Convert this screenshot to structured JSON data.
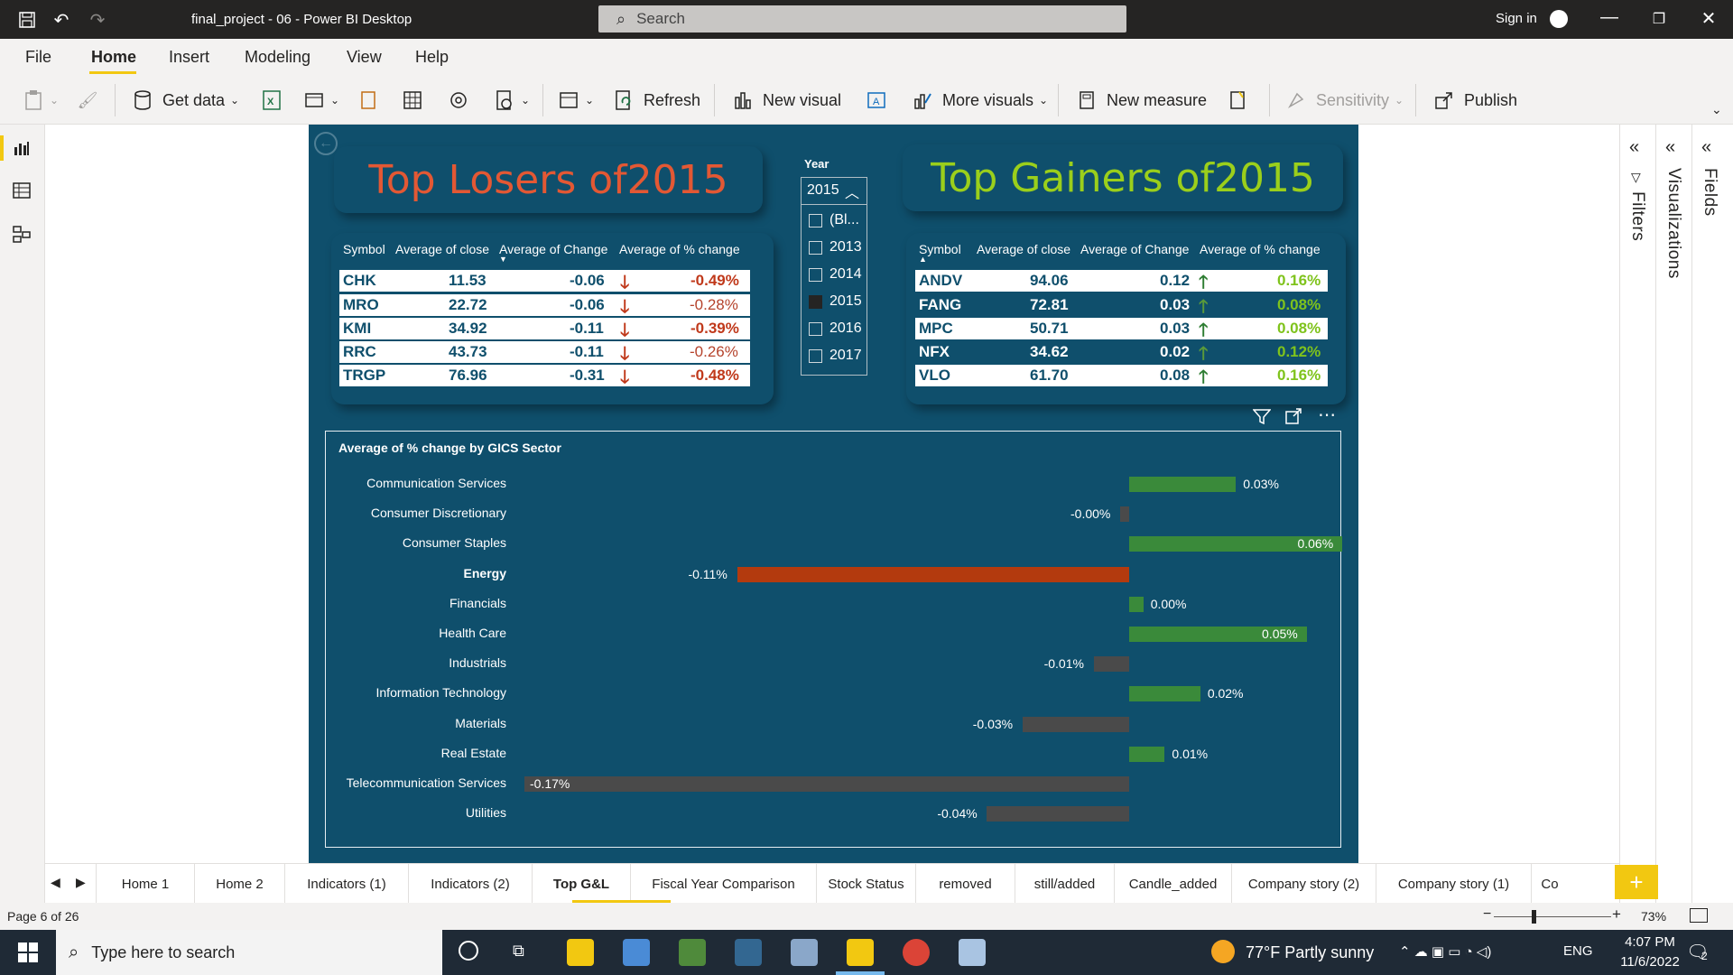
{
  "window": {
    "title": "final_project - 06 - Power BI Desktop",
    "search_placeholder": "Search",
    "sign_in": "Sign in"
  },
  "menu": {
    "items": [
      "File",
      "Home",
      "Insert",
      "Modeling",
      "View",
      "Help"
    ],
    "active": "Home"
  },
  "ribbon": {
    "get_data": "Get data",
    "refresh": "Refresh",
    "new_visual": "New visual",
    "more_visuals": "More visuals",
    "new_measure": "New measure",
    "sensitivity": "Sensitivity",
    "publish": "Publish"
  },
  "panes": {
    "filters": "Filters",
    "visualizations": "Visualizations",
    "fields": "Fields"
  },
  "report": {
    "losers_title": "Top Losers of2015",
    "gainers_title": "Top Gainers of2015",
    "table_headers": [
      "Symbol",
      "Average of close",
      "Average of Change",
      "Average of % change"
    ],
    "losers": [
      {
        "symbol": "CHK",
        "close": "11.53",
        "change": "-0.06",
        "pct": "-0.49%"
      },
      {
        "symbol": "MRO",
        "close": "22.72",
        "change": "-0.06",
        "pct": "-0.28%"
      },
      {
        "symbol": "KMI",
        "close": "34.92",
        "change": "-0.11",
        "pct": "-0.39%"
      },
      {
        "symbol": "RRC",
        "close": "43.73",
        "change": "-0.11",
        "pct": "-0.26%"
      },
      {
        "symbol": "TRGP",
        "close": "76.96",
        "change": "-0.31",
        "pct": "-0.48%"
      }
    ],
    "gainers": [
      {
        "symbol": "ANDV",
        "close": "94.06",
        "change": "0.12",
        "pct": "0.16%"
      },
      {
        "symbol": "FANG",
        "close": "72.81",
        "change": "0.03",
        "pct": "0.08%"
      },
      {
        "symbol": "MPC",
        "close": "50.71",
        "change": "0.03",
        "pct": "0.08%"
      },
      {
        "symbol": "NFX",
        "close": "34.62",
        "change": "0.02",
        "pct": "0.12%"
      },
      {
        "symbol": "VLO",
        "close": "61.70",
        "change": "0.08",
        "pct": "0.16%"
      }
    ],
    "slicer": {
      "label": "Year",
      "selected": "2015",
      "options": [
        "(Bl...",
        "2013",
        "2014",
        "2015",
        "2016",
        "2017"
      ],
      "checked": "2015"
    }
  },
  "chart_data": {
    "type": "bar",
    "orientation": "horizontal",
    "title": "Average of % change by GICS Sector",
    "categories": [
      "Communication Services",
      "Consumer Discretionary",
      "Consumer Staples",
      "Energy",
      "Financials",
      "Health Care",
      "Industrials",
      "Information Technology",
      "Materials",
      "Real Estate",
      "Telecommunication Services",
      "Utilities"
    ],
    "values": [
      0.03,
      -0.002,
      0.06,
      -0.11,
      0.004,
      0.05,
      -0.01,
      0.02,
      -0.03,
      0.01,
      -0.17,
      -0.04
    ],
    "labels": [
      "0.03%",
      "-0.00%",
      "0.06%",
      "-0.11%",
      "0.00%",
      "0.05%",
      "-0.01%",
      "0.02%",
      "-0.03%",
      "0.01%",
      "-0.17%",
      "-0.04%"
    ],
    "highlighted": "Energy",
    "colors": {
      "positive": "#3a8a3a",
      "negative": "#4a4a4a",
      "highlight": "#b33a0e"
    },
    "xlim": [
      -0.17,
      0.06
    ]
  },
  "tabs": {
    "pages": [
      "Home 1",
      "Home 2",
      "Indicators (1)",
      "Indicators (2)",
      "Top G&L",
      "Fiscal Year Comparison",
      "Stock Status",
      "removed",
      "still/added",
      "Candle_added",
      "Company story (2)",
      "Company story (1)",
      "Co"
    ],
    "active": "Top G&L"
  },
  "status": {
    "page": "Page 6 of 26",
    "zoom": "73%"
  },
  "taskbar": {
    "search_placeholder": "Type here to search",
    "weather": "77°F  Partly sunny",
    "lang": "ENG",
    "time": "4:07 PM",
    "date": "11/6/2022",
    "notif_count": "2"
  },
  "colors": {
    "report_bg": "#0f4f6c",
    "accent": "#f2c811",
    "loser_red": "#e35834",
    "gainer_green": "#9bcf1b"
  }
}
